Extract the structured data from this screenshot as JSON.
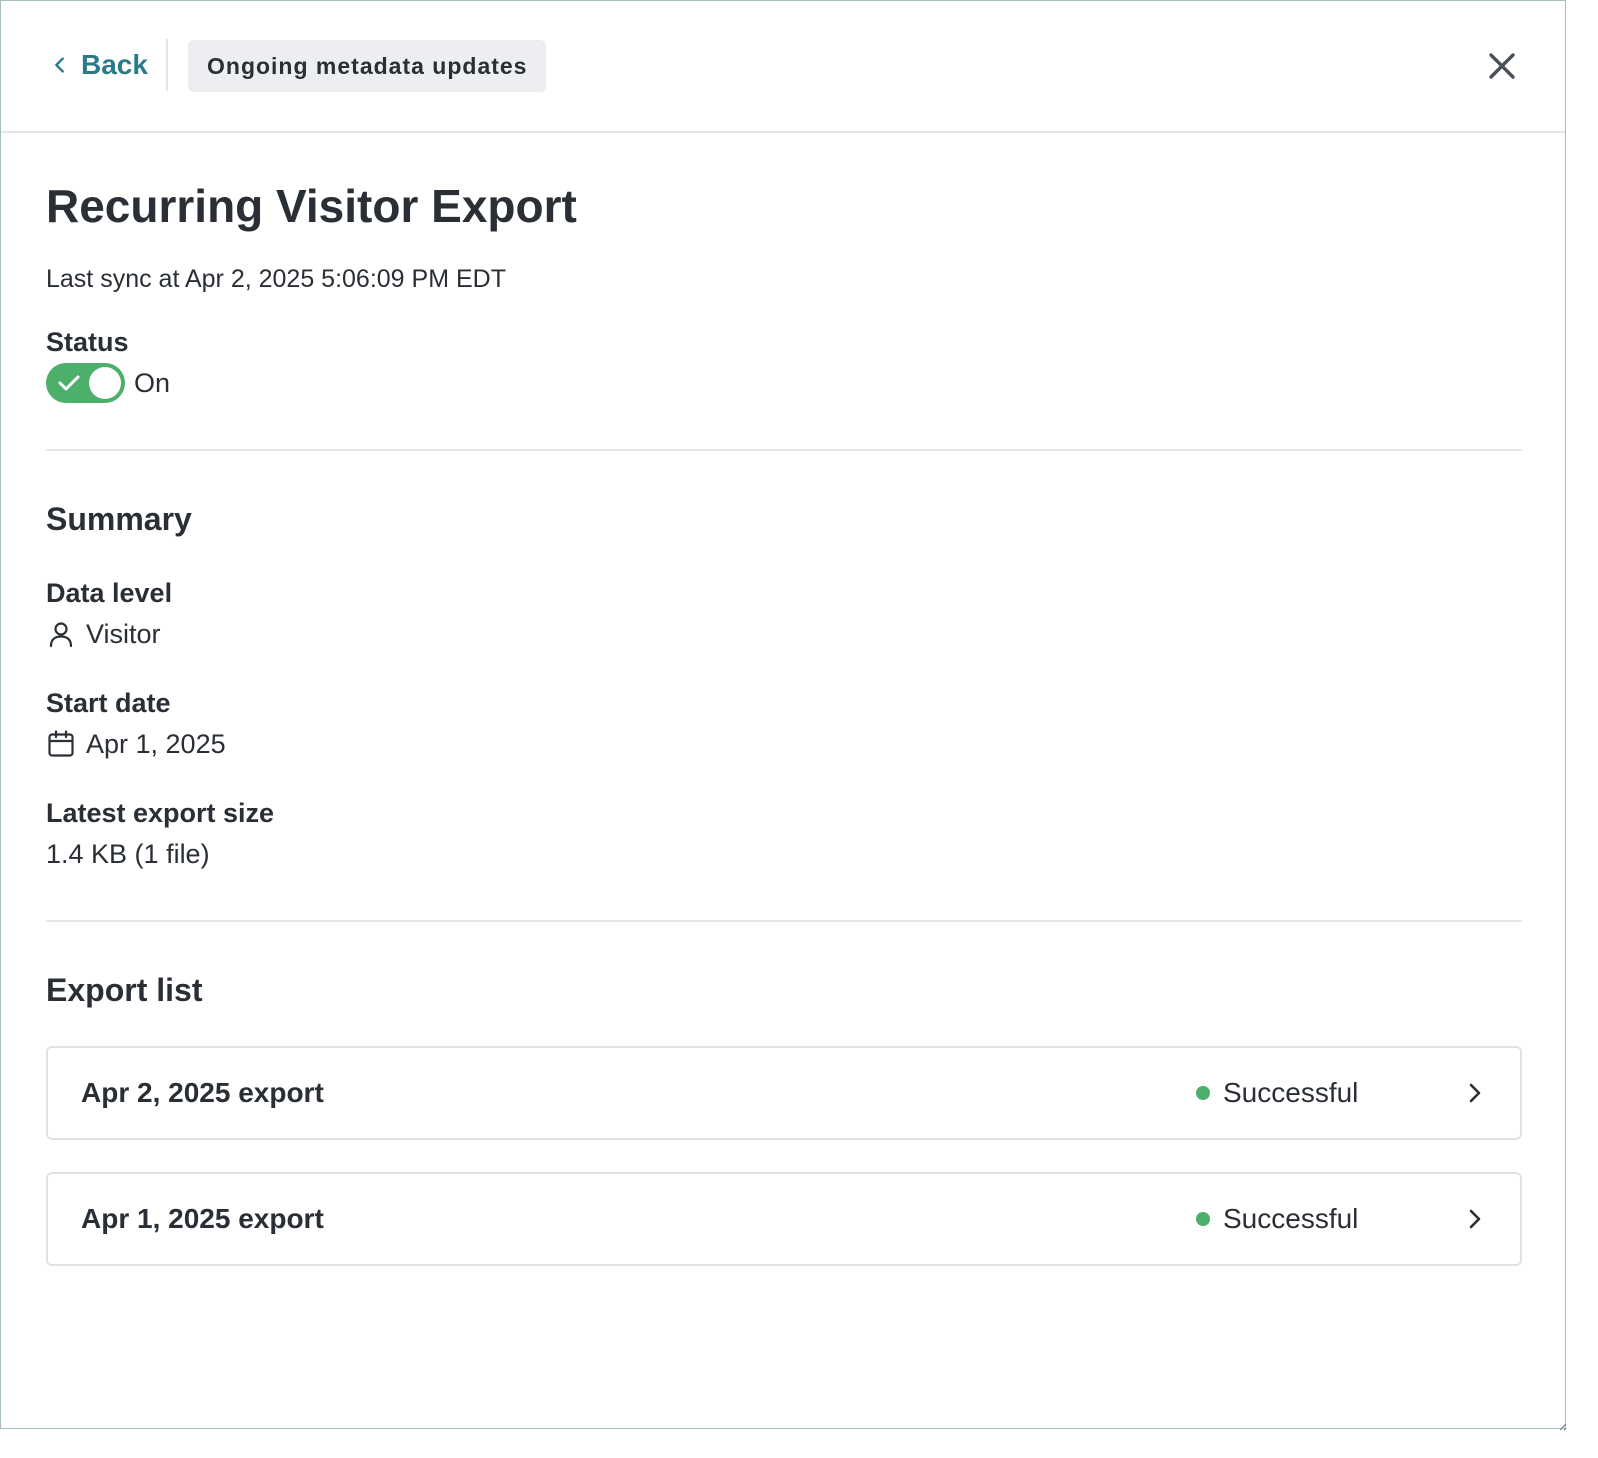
{
  "header": {
    "back_label": "Back",
    "chip_label": "Ongoing metadata updates"
  },
  "page": {
    "title": "Recurring Visitor Export",
    "last_sync": "Last sync at Apr 2, 2025 5:06:09 PM EDT"
  },
  "status": {
    "label": "Status",
    "toggle_on": true,
    "value": "On",
    "color": "#4caf6a"
  },
  "summary": {
    "title": "Summary",
    "data_level": {
      "label": "Data level",
      "value": "Visitor",
      "icon": "user-icon"
    },
    "start_date": {
      "label": "Start date",
      "value": "Apr 1, 2025",
      "icon": "calendar-icon"
    },
    "export_size": {
      "label": "Latest export size",
      "value": "1.4 KB (1 file)"
    }
  },
  "export_list": {
    "title": "Export list",
    "items": [
      {
        "name": "Apr 2, 2025 export",
        "status": "Successful"
      },
      {
        "name": "Apr 1, 2025 export",
        "status": "Successful"
      }
    ]
  },
  "colors": {
    "accent": "#2b7a8a",
    "success": "#4caf6a",
    "text": "#2a2f36",
    "divider": "#e3e6ea"
  }
}
